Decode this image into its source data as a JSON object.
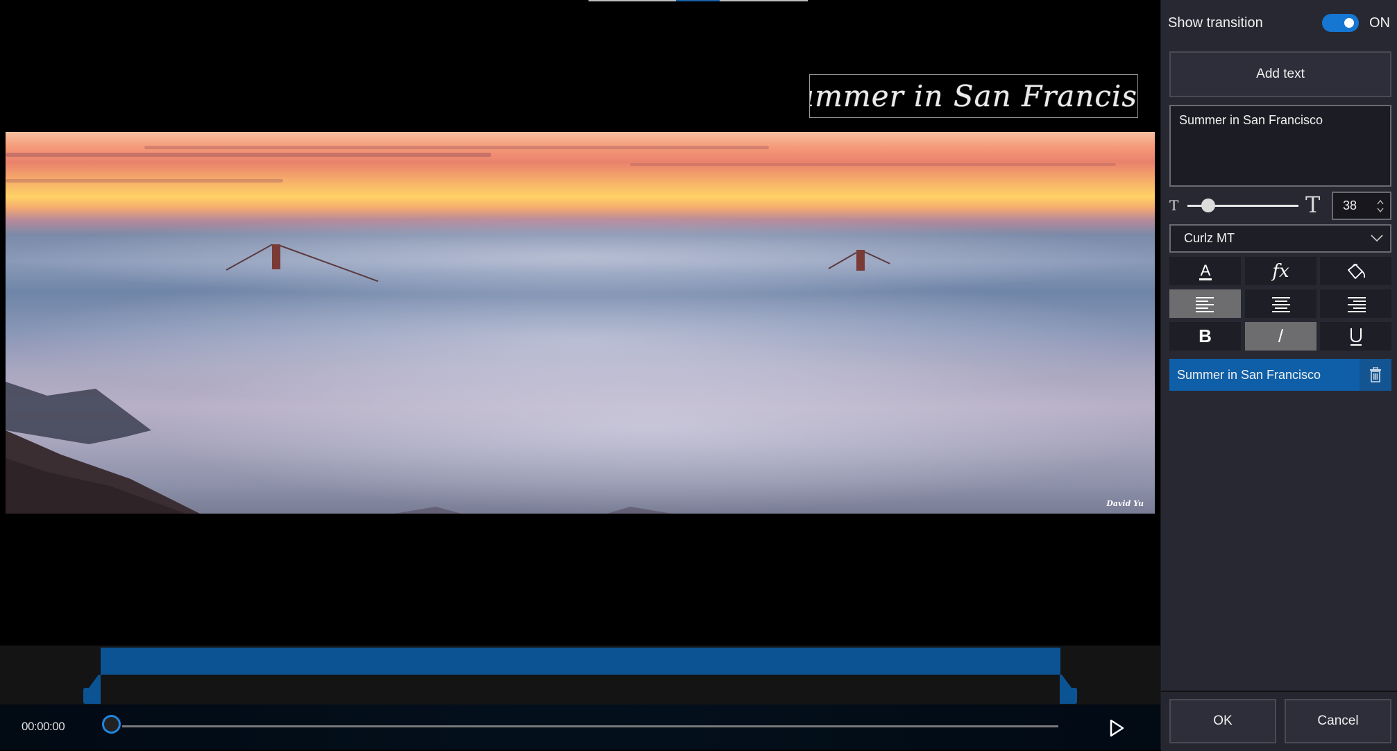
{
  "preview": {
    "title_overlay_text": "Summer in San Francisco",
    "photo_watermark": "David Yu",
    "photo_description": "Golden Gate Bridge towers above fog at sunset"
  },
  "timeline": {
    "current_time": "00:00:00",
    "playhead_progress": 0,
    "clip_color": "#0c5394"
  },
  "panel": {
    "show_transition_label": "Show transition",
    "show_transition_on": true,
    "show_transition_state": "ON",
    "add_text_label": "Add text",
    "text_value": "Summer in San Francisco",
    "font_size": "38",
    "font_size_slider_fraction": 0.19,
    "font_name": "Curlz MT",
    "font_size_small_glyph": "T",
    "font_size_large_glyph": "T",
    "tools": {
      "font_color": {
        "icon": "font-color-icon",
        "glyph": "A"
      },
      "effects": {
        "icon": "fx-icon",
        "glyph": "fx"
      },
      "fill": {
        "icon": "paint-bucket-icon"
      },
      "align_left": {
        "icon": "align-left-icon",
        "active": true
      },
      "align_center": {
        "icon": "align-center-icon",
        "active": false
      },
      "align_right": {
        "icon": "align-right-icon",
        "active": false
      },
      "bold": {
        "icon": "bold-icon",
        "glyph": "B",
        "active": false
      },
      "italic": {
        "icon": "italic-icon",
        "glyph": "/",
        "active": true
      },
      "underline": {
        "icon": "underline-icon",
        "glyph": "U",
        "active": false
      }
    },
    "text_items": [
      {
        "label": "Summer in San Francisco",
        "selected": true
      }
    ],
    "ok_label": "OK",
    "cancel_label": "Cancel",
    "accent_color": "#1677d2"
  }
}
